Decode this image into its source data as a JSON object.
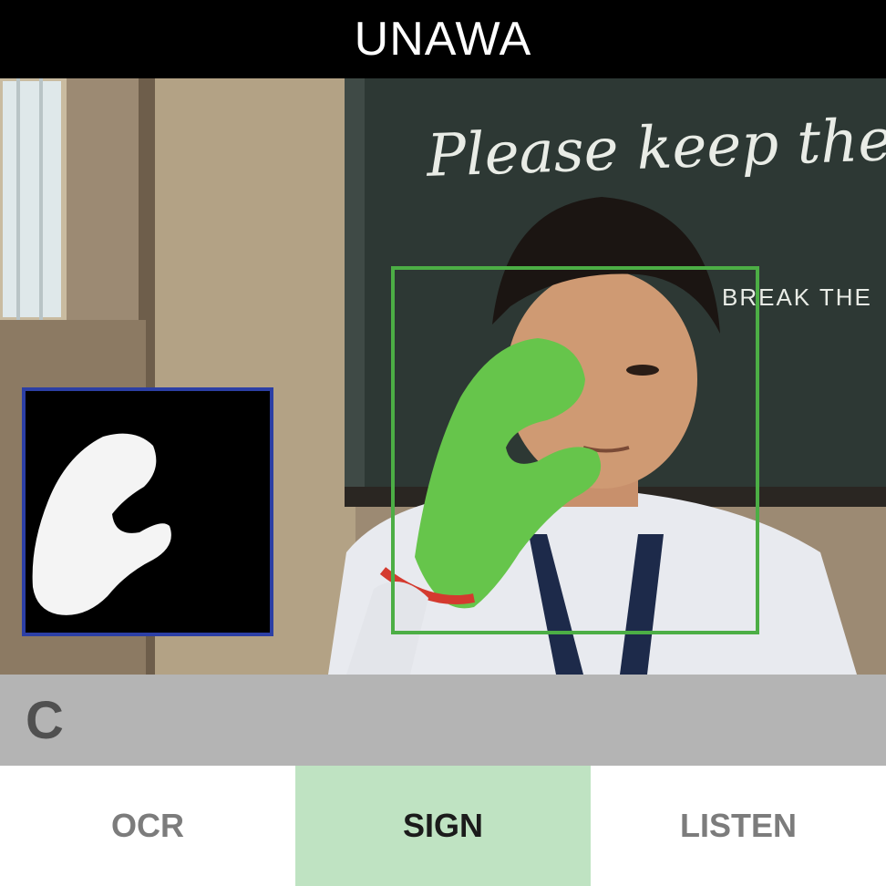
{
  "app": {
    "title": "UNAWA"
  },
  "camera": {
    "chalk_text": [
      "Please keep the",
      "BREAK THE"
    ],
    "detection_box_color": "#4cae45",
    "mask_border_color": "#2c3fa5"
  },
  "result": {
    "letter": "C"
  },
  "tabs": [
    {
      "label": "OCR",
      "active": false
    },
    {
      "label": "SIGN",
      "active": true
    },
    {
      "label": "LISTEN",
      "active": false
    }
  ],
  "colors": {
    "header_bg": "#000000",
    "result_bg": "#b4b4b4",
    "active_tab_bg": "#bfe3c2"
  }
}
